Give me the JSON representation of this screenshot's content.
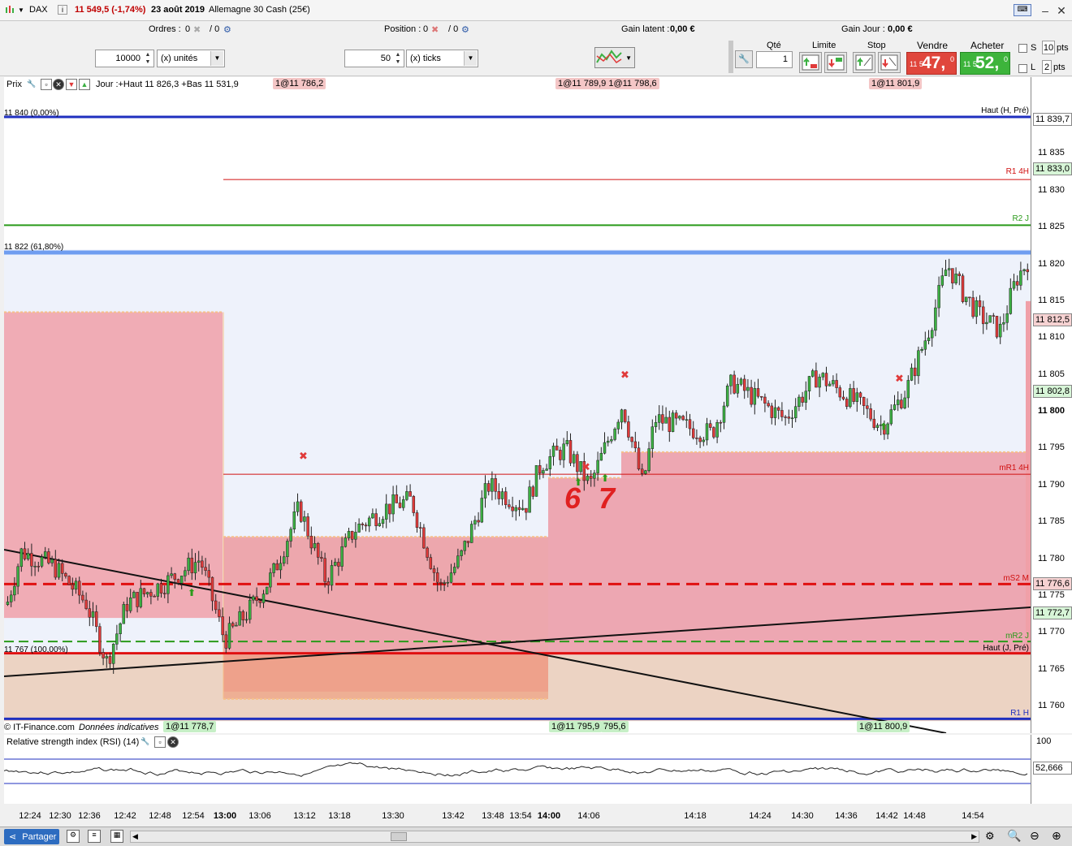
{
  "titlebar": {
    "instrument": "DAX",
    "info_icon": "i",
    "price_change": "11 549,5 (-1,74%)",
    "date": "23 août 2019",
    "market": "Allemagne 30 Cash (25€)"
  },
  "infobar": {
    "orders_label": "Ordres :",
    "orders_value": "0",
    "orders_total": "/ 0",
    "position_label": "Position :",
    "position_value": "0",
    "position_total": "/ 0",
    "gain_latent_label": "Gain latent :",
    "gain_latent_value": "0,00 €",
    "gain_jour_label": "Gain Jour :",
    "gain_jour_value": "0,00 €"
  },
  "controls": {
    "quantity_value": "10000",
    "quantity_unit": "(x) unités",
    "ticks_value": "50",
    "ticks_unit": "(x) ticks",
    "qte_label": "Qté",
    "qte_value": "1",
    "limite_label": "Limite",
    "stop_label": "Stop",
    "vendre_label": "Vendre",
    "acheter_label": "Acheter",
    "sell_price_small": "11 5",
    "sell_price_big": "47,",
    "sell_price_sup": "0",
    "buy_price_small": "11 5",
    "buy_price_big": "52,",
    "buy_price_sup": "0",
    "s_label": "S",
    "s_pts_value": "10",
    "l_label": "L",
    "l_pts_value": "2",
    "pts_label": "pts"
  },
  "chart_header": {
    "prix_label": "Prix",
    "jour_text": "Jour :+Haut 11 826,3 +Bas 11 531,9",
    "tags": [
      "1@11 786,2",
      "1@11 789,9 1@11 798,6",
      "1@11 801,9"
    ],
    "footer_source": "© IT-Finance.com",
    "footer_note": "Données indicatives",
    "footer_tags_green": [
      "1@11 778,7",
      "1@11 795,9",
      "795,6",
      "1@11 800,9"
    ]
  },
  "levels": {
    "fib_top": "11 840 (0,00%)",
    "fib_mid": "11 822 (61,80%)",
    "fib_bottom": "11 767 (100,00%)",
    "haut_h_pre": "Haut (H, Pré)",
    "r1_4h": "R1 4H",
    "r2_j": "R2 J",
    "mr1_4h": "mR1 4H",
    "ms2_m": "mS2 M",
    "mr2_j": "mR2 J",
    "haut_j_pre": "Haut (J, Pré)",
    "r1_h": "R1 H"
  },
  "price_axis": {
    "ticks": [
      "11 835",
      "11 830",
      "11 825",
      "11 820",
      "11 815",
      "11 810",
      "11 805",
      "11 800",
      "11 795",
      "11 790",
      "11 785",
      "11 780",
      "11 775",
      "11 770",
      "11 765",
      "11 760"
    ],
    "badges": [
      {
        "text": "11 839,7",
        "color": "#ffffff"
      },
      {
        "text": "11 833,0",
        "color": "#d7f5d7"
      },
      {
        "text": "11 812,5",
        "color": "#f6d2d2"
      },
      {
        "text": "11 802,8",
        "color": "#d7f5d7"
      },
      {
        "text": "11 776,6",
        "color": "#f6d2d2"
      },
      {
        "text": "11 772,7",
        "color": "#d7f5d7"
      }
    ]
  },
  "rsi": {
    "title": "Relative strength index (RSI) (14)",
    "scale_top": "100",
    "current": "52,666"
  },
  "time_axis": [
    "12:24",
    "12:30",
    "12:36",
    "12:42",
    "12:48",
    "12:54",
    "13:00",
    "13:06",
    "13:12",
    "13:18",
    "13:30",
    "13:42",
    "13:48",
    "13:54",
    "14:00",
    "14:06",
    "14:18",
    "14:24",
    "14:30",
    "14:36",
    "14:42",
    "14:48",
    "14:54"
  ],
  "annotations": {
    "hand_6": "6",
    "hand_7": "7"
  },
  "bottombar": {
    "partager_label": "Partager"
  },
  "colors": {
    "bull": "#3cb043",
    "bear": "#e03a3a",
    "fib_blue": "#1f2fbf",
    "pink_zone": "#f0a0a8",
    "sell": "#e0463c",
    "buy": "#3db43b"
  }
}
